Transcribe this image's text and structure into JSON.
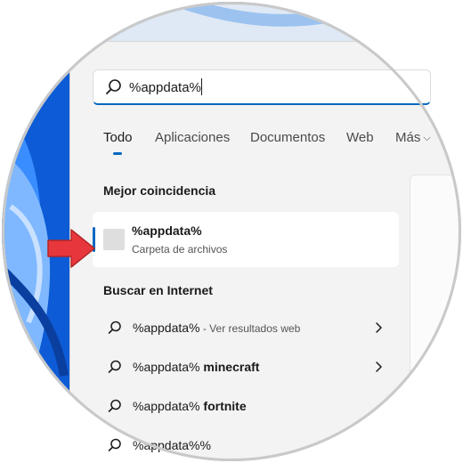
{
  "search": {
    "value": "%appdata%"
  },
  "tabs": [
    {
      "label": "Todo"
    },
    {
      "label": "Aplicaciones"
    },
    {
      "label": "Documentos"
    },
    {
      "label": "Web"
    },
    {
      "label": "Más"
    }
  ],
  "best_match": {
    "heading": "Mejor coincidencia",
    "title": "%appdata%",
    "subtitle": "Carpeta de archivos"
  },
  "internet": {
    "heading": "Buscar en Internet",
    "results": [
      {
        "query": "%appdata%",
        "suffix": " - Ver resultados web"
      },
      {
        "query": "%appdata%",
        "bold_suffix": " minecraft"
      },
      {
        "query": "%appdata%",
        "bold_suffix": " fortnite"
      },
      {
        "query": "%appdata%%"
      }
    ]
  },
  "colors": {
    "accent": "#0067c0",
    "arrow": "#e8373c",
    "wallpaper": "#1565d8"
  }
}
